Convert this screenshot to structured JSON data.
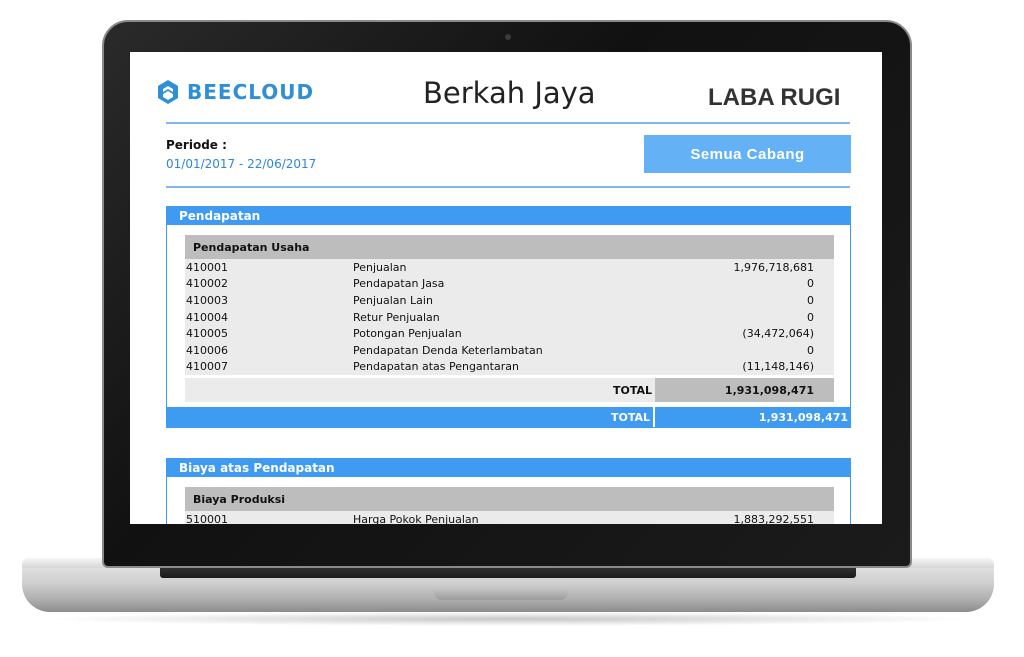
{
  "header": {
    "logo_text": "BEECLOUD",
    "company_name": "Berkah Jaya",
    "report_title": "LABA RUGI"
  },
  "periode": {
    "label": "Periode :",
    "range": "01/01/2017 -  22/06/2017"
  },
  "branch_button": {
    "label": "Semua  Cabang"
  },
  "pendapatan": {
    "title": "Pendapatan",
    "group_title": "Pendapatan Usaha",
    "rows": [
      {
        "code": "410001",
        "name": "Penjualan",
        "amount": "1,976,718,681"
      },
      {
        "code": "410002",
        "name": "Pendapatan Jasa",
        "amount": "0"
      },
      {
        "code": "410003",
        "name": "Penjualan Lain",
        "amount": "0"
      },
      {
        "code": "410004",
        "name": "Retur Penjualan",
        "amount": "0"
      },
      {
        "code": "410005",
        "name": "Potongan Penjualan",
        "amount": "(34,472,064)"
      },
      {
        "code": "410006",
        "name": "Pendapatan Denda Keterlambatan",
        "amount": "0"
      },
      {
        "code": "410007",
        "name": "Pendapatan atas Pengantaran",
        "amount": "(11,148,146)"
      }
    ],
    "group_total_label": "TOTAL",
    "group_total_value": "1,931,098,471",
    "section_total_label": "TOTAL",
    "section_total_value": "1,931,098,471"
  },
  "biaya": {
    "title": "Biaya atas Pendapatan",
    "group_title": "Biaya Produksi",
    "rows": [
      {
        "code": "510001",
        "name": "Harga Pokok Penjualan",
        "amount": "1,883,292,551"
      }
    ]
  },
  "colors": {
    "accent": "#3f9bf2",
    "button": "#64b1f5",
    "logo": "#2e8fd6"
  }
}
